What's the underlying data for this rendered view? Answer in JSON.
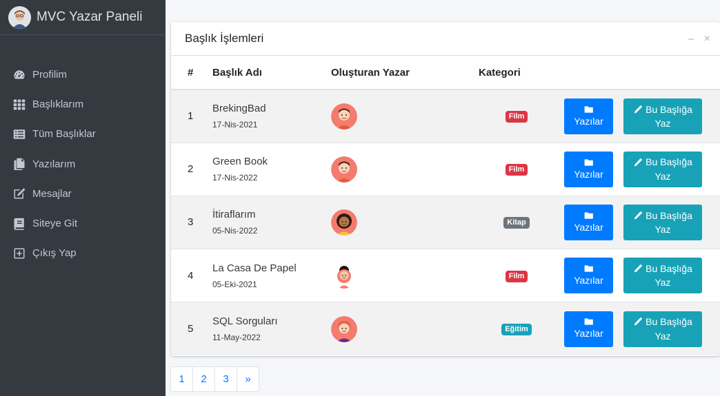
{
  "brand": {
    "title": "MVC Yazar Paneli"
  },
  "sidebar": {
    "items": [
      {
        "label": "Profilim",
        "icon": "dashboard-gauge-icon"
      },
      {
        "label": "Başlıklarım",
        "icon": "grid-icon"
      },
      {
        "label": "Tüm Başlıklar",
        "icon": "list-icon"
      },
      {
        "label": "Yazılarım",
        "icon": "copy-icon"
      },
      {
        "label": "Mesajlar",
        "icon": "edit-icon"
      },
      {
        "label": "Siteye Git",
        "icon": "book-icon"
      },
      {
        "label": "Çıkış Yap",
        "icon": "plus-square-icon"
      }
    ]
  },
  "card": {
    "title": "Başlık İşlemleri",
    "tools": {
      "collapse": "–",
      "remove": "×"
    }
  },
  "table": {
    "headers": [
      "#",
      "Başlık Adı",
      "Oluşturan Yazar",
      "Kategori"
    ],
    "rows": [
      {
        "num": "1",
        "title": "BrekingBad",
        "date": "17-Nis-2021",
        "category": "Film"
      },
      {
        "num": "2",
        "title": "Green Book",
        "date": "17-Nis-2022",
        "category": "Film"
      },
      {
        "num": "3",
        "title": "İtiraflarım",
        "date": "05-Nis-2022",
        "category": "Kitap"
      },
      {
        "num": "4",
        "title": "La Casa De Papel",
        "date": "05-Eki-2021",
        "category": "Film"
      },
      {
        "num": "5",
        "title": "SQL Sorguları",
        "date": "11-May-2022",
        "category": "Eğitim"
      }
    ]
  },
  "buttons": {
    "writings": "Yazılar",
    "write_line1": "Bu Başlığa",
    "write_line2": "Yaz"
  },
  "pagination": [
    "1",
    "2",
    "3",
    "»"
  ],
  "colors": {
    "sidebar_bg": "#343a40",
    "film": "#dc3545",
    "kitap": "#6c757d",
    "egitim": "#17a2b8",
    "primary": "#007bff",
    "info": "#17a2b8"
  }
}
